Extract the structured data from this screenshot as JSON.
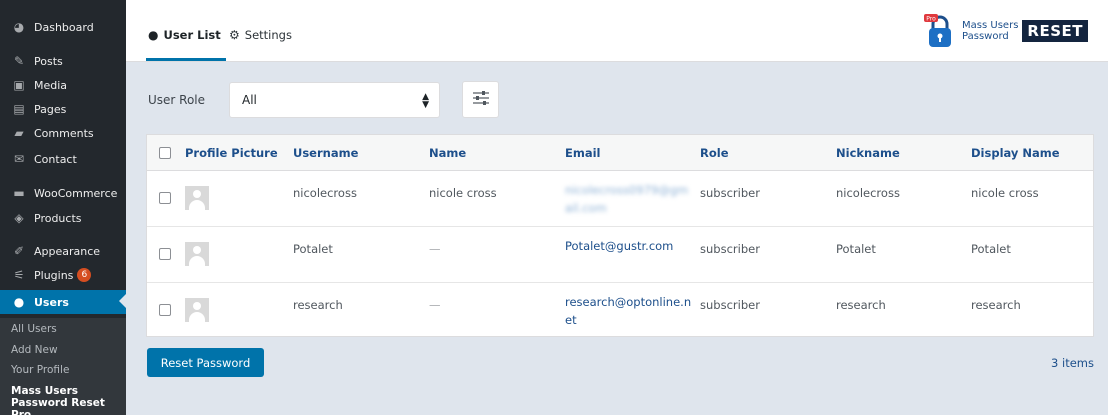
{
  "sidebar": {
    "items": [
      {
        "label": "Dashboard",
        "icon": "dashboard-icon",
        "glyph": "◕"
      },
      {
        "label": "Posts",
        "icon": "pin-icon",
        "glyph": "✎"
      },
      {
        "label": "Media",
        "icon": "media-icon",
        "glyph": "▣"
      },
      {
        "label": "Pages",
        "icon": "pages-icon",
        "glyph": "▤"
      },
      {
        "label": "Comments",
        "icon": "comment-icon",
        "glyph": "▰"
      },
      {
        "label": "Contact",
        "icon": "mail-icon",
        "glyph": "✉"
      },
      {
        "label": "WooCommerce",
        "icon": "woocommerce-icon",
        "glyph": "▬"
      },
      {
        "label": "Products",
        "icon": "products-icon",
        "glyph": "◈"
      },
      {
        "label": "Appearance",
        "icon": "brush-icon",
        "glyph": "✐"
      },
      {
        "label": "Plugins",
        "icon": "plugin-icon",
        "glyph": "⚟",
        "badge": "6"
      },
      {
        "label": "Users",
        "icon": "user-icon",
        "glyph": "●"
      }
    ],
    "submenu": [
      "All Users",
      "Add New",
      "Your Profile"
    ],
    "submenu_current": "Mass Users Password Reset Pro"
  },
  "tabs": [
    {
      "label": "User List",
      "icon": "user-list-icon",
      "glyph": "●"
    },
    {
      "label": "Settings",
      "icon": "gear-icon",
      "glyph": "⚙"
    }
  ],
  "brand": {
    "line1": "Mass Users",
    "line2": "Password",
    "reset": "RESET",
    "tag": "Pro"
  },
  "filter": {
    "label": "User Role",
    "value": "All"
  },
  "table": {
    "headers": [
      "Profile Picture",
      "Username",
      "Name",
      "Email",
      "Role",
      "Nickname",
      "Display Name"
    ],
    "rows": [
      {
        "username": "nicolecross",
        "name": "nicole cross",
        "email": "nicolecross0979@gmail.com",
        "role": "subscriber",
        "nickname": "nicolecross",
        "display": "nicole cross"
      },
      {
        "username": "Potalet",
        "name": "—",
        "email": "Potalet@gustr.com",
        "role": "subscriber",
        "nickname": "Potalet",
        "display": "Potalet"
      },
      {
        "username": "research",
        "name": "—",
        "email": "research@optonline.net",
        "role": "subscriber",
        "nickname": "research",
        "display": "research"
      }
    ]
  },
  "actions": {
    "reset_label": "Reset Password",
    "count": "3 items"
  }
}
